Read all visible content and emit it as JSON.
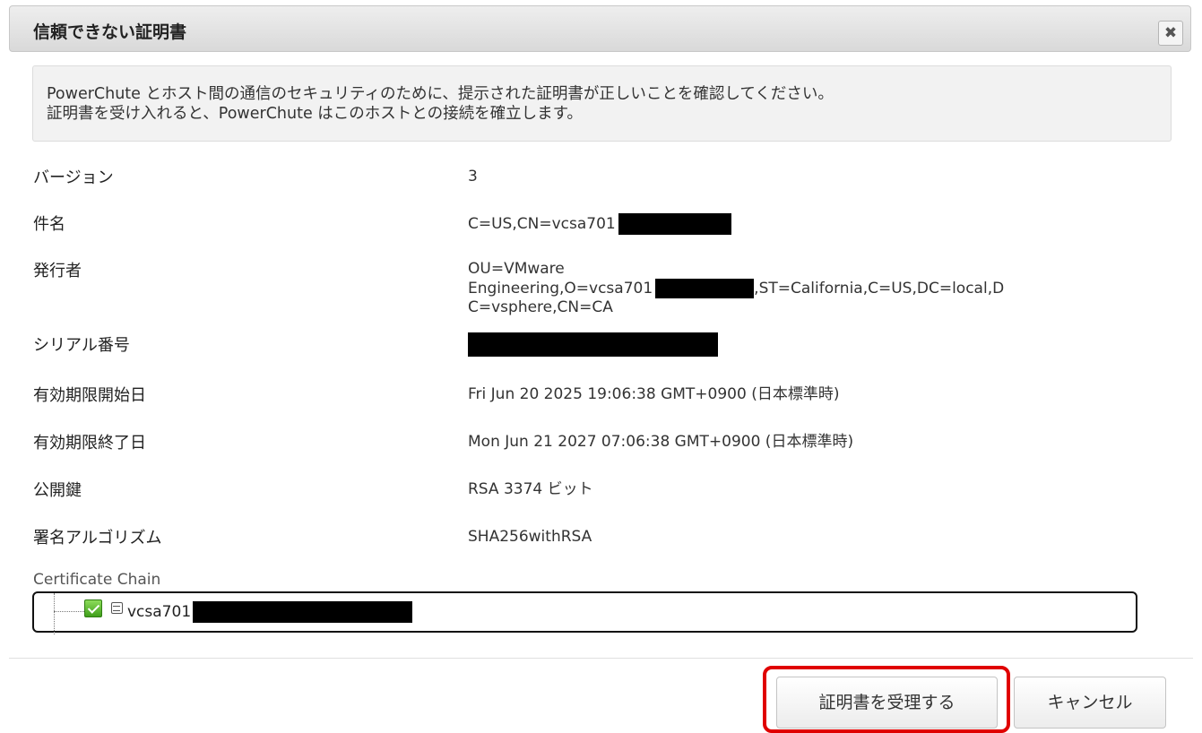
{
  "dialog": {
    "title": "信頼できない証明書",
    "close_label": "✖"
  },
  "notice": {
    "line1": "PowerChute とホスト間の通信のセキュリティのために、提示された証明書が正しいことを確認してください。",
    "line2": "証明書を受け入れると、PowerChute はこのホストとの接続を確立します。"
  },
  "details": {
    "version": {
      "label": "バージョン",
      "value": "3"
    },
    "subject": {
      "label": "件名",
      "value": "C=US,CN=vcsa701"
    },
    "issuer": {
      "label": "発行者",
      "line1": "OU=VMware",
      "line2_pre": "Engineering,O=vcsa701",
      "line2_post": ",ST=California,C=US,DC=local,D",
      "line3": "C=vsphere,CN=CA"
    },
    "serial": {
      "label": "シリアル番号"
    },
    "valid_from": {
      "label": "有効期限開始日",
      "value": "Fri Jun 20 2025 19:06:38 GMT+0900 (日本標準時)"
    },
    "valid_to": {
      "label": "有効期限終了日",
      "value": "Mon Jun 21 2027 07:06:38 GMT+0900 (日本標準時)"
    },
    "public_key": {
      "label": "公開鍵",
      "value": "RSA 3374 ビット"
    },
    "signature_algorithm": {
      "label": "署名アルゴリズム",
      "value": "SHA256withRSA"
    }
  },
  "chain": {
    "label": "Certificate Chain",
    "items": [
      {
        "name": "vcsa701",
        "icon": "certificate-icon",
        "checked": true
      }
    ]
  },
  "buttons": {
    "accept": "証明書を受理する",
    "cancel": "キャンセル"
  },
  "colors": {
    "highlight": "#e00000",
    "redaction": "#000000"
  }
}
